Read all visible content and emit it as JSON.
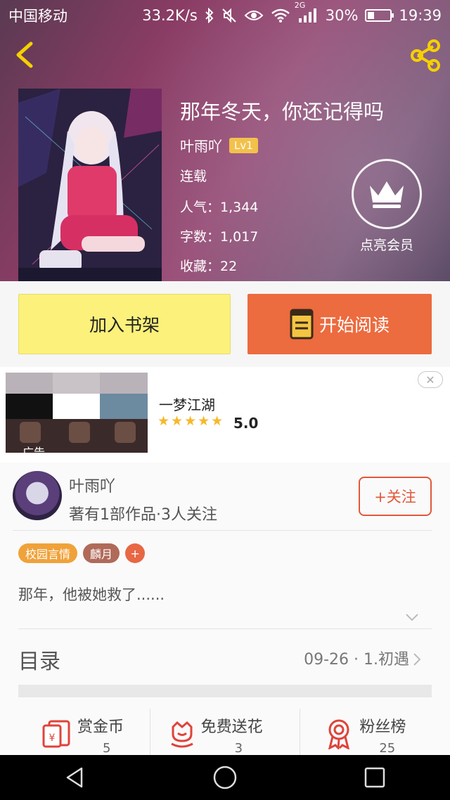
{
  "status_bar": {
    "carrier": "中国移动",
    "speed": "33.2K/s",
    "network": "2G",
    "battery": "30%",
    "time": "19:39"
  },
  "book": {
    "title": "那年冬天，你还记得吗",
    "author": "叶雨吖",
    "level": "Lv1",
    "status": "连载",
    "popularity_line": "人气：1,344",
    "words_line": "字数：1,017",
    "favorites_line": "收藏：22"
  },
  "vip": {
    "label": "点亮会员"
  },
  "actions": {
    "add_shelf": "加入书架",
    "start_read": "开始阅读"
  },
  "ad": {
    "title": "一梦江湖",
    "rating": "5.0",
    "stars": "★★★★★",
    "mark": "广告",
    "close": "✕"
  },
  "author": {
    "name": "叶雨吖",
    "stats": "著有1部作品·3人关注",
    "follow": "+关注"
  },
  "tags": [
    "校园言情",
    "麟月",
    "+"
  ],
  "synopsis": "那年，他被她救了......",
  "toc": {
    "title": "目录",
    "latest": "09-26 · 1.初遇"
  },
  "features": [
    {
      "label": "赏金币",
      "count": "5",
      "icon": "red-envelope-icon"
    },
    {
      "label": "免费送花",
      "count": "3",
      "icon": "flower-icon"
    },
    {
      "label": "粉丝榜",
      "count": "25",
      "icon": "award-ribbon-icon"
    }
  ],
  "colors": {
    "accent_orange": "#ec6b3f",
    "shelf_yellow": "#fbf17b",
    "badge_yellow": "#f3c14b",
    "icon_red": "#e0433a"
  }
}
